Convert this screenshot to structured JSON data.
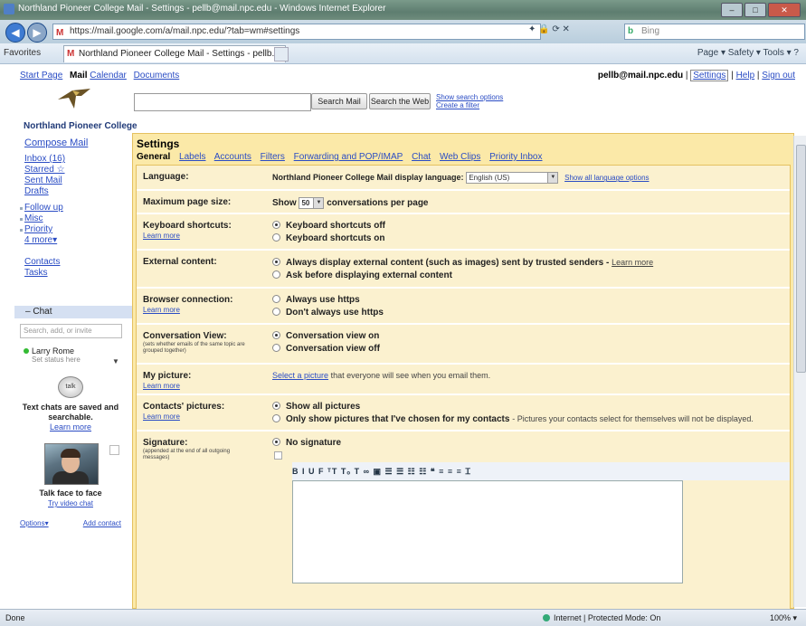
{
  "browser": {
    "window_title": "Northland Pioneer College Mail - Settings - pellb@mail.npc.edu - Windows Internet Explorer",
    "address": "https://mail.google.com/a/mail.npc.edu/?tab=wm#settings",
    "search_placeholder": "Bing",
    "favorites_label": "Favorites",
    "tab_title": "Northland Pioneer College Mail - Settings - pellb...",
    "addr_tools": "✦ 🔒 ⟳ ✕",
    "right_tools": "Page ▾   Safety ▾   Tools ▾   ?",
    "status_left": "Done",
    "zone": "Internet | Protected Mode: On",
    "zoom": "100%"
  },
  "gbar": {
    "start_page": "Start Page",
    "mail": "Mail",
    "calendar": "Calendar",
    "documents": "Documents",
    "email": "pellb@mail.npc.edu",
    "settings": "Settings",
    "help": "Help",
    "sign_out": "Sign out"
  },
  "logo": {
    "name": "Northland Pioneer College"
  },
  "search": {
    "search_mail": "Search Mail",
    "search_web": "Search the Web",
    "show_options": "Show search options",
    "create_filter": "Create a filter"
  },
  "nav": {
    "compose": "Compose Mail",
    "items": [
      "Inbox (16)",
      "Starred ☆",
      "Sent Mail",
      "Drafts"
    ],
    "labels": [
      "Follow up",
      "Misc",
      "Priority",
      "4 more▾"
    ],
    "contacts": "Contacts",
    "tasks": "Tasks"
  },
  "chat": {
    "header": "Chat",
    "search_placeholder": "Search, add, or invite",
    "contact_name": "Larry Rome",
    "contact_status": "Set status here",
    "talk_label": "talk",
    "saved_text": "Text chats are saved and searchable.",
    "learn_more": "Learn more",
    "face_title": "Talk face to face",
    "face_link": "Try video chat",
    "options": "Options▾",
    "add_contact": "Add contact"
  },
  "settings": {
    "title": "Settings",
    "tabs": [
      "General",
      "Labels",
      "Accounts",
      "Filters",
      "Forwarding and POP/IMAP",
      "Chat",
      "Web Clips",
      "Priority Inbox"
    ],
    "language": {
      "label": "Language:",
      "text": "Northland Pioneer College Mail display language:",
      "value": "English (US)",
      "link": "Show all language options"
    },
    "page_size": {
      "label": "Maximum page size:",
      "show": "Show",
      "value": "50",
      "suffix": "conversations per page"
    },
    "keyboard": {
      "label": "Keyboard shortcuts:",
      "learn": "Learn more",
      "opt1": "Keyboard shortcuts off",
      "opt2": "Keyboard shortcuts on"
    },
    "external": {
      "label": "External content:",
      "opt1": "Always display external content (such as images) sent by trusted senders",
      "learn": "Learn more",
      "opt2": "Ask before displaying external content"
    },
    "browser_conn": {
      "label": "Browser connection:",
      "learn": "Learn more",
      "opt1": "Always use https",
      "opt2": "Don't always use https"
    },
    "conversation": {
      "label": "Conversation View:",
      "hint": "(sets whether emails of the same topic are grouped together)",
      "opt1": "Conversation view on",
      "opt2": "Conversation view off"
    },
    "picture": {
      "label": "My picture:",
      "learn": "Learn more",
      "link": "Select a picture",
      "text": "that everyone will see when you email them."
    },
    "contacts_pic": {
      "label": "Contacts' pictures:",
      "learn": "Learn more",
      "opt1": "Show all pictures",
      "opt2": "Only show pictures that I've chosen for my contacts",
      "opt2_suffix": "- Pictures your contacts select for themselves will not be displayed."
    },
    "signature": {
      "label": "Signature:",
      "hint": "(appended at the end of all outgoing messages)",
      "opt1": "No signature",
      "toolbar": "B  I  U  F  ᵀT  Tₒ  T  ∞  ▣  ☰  ☰  ☷  ☷  ❝  ≡  ≡  ≡  Ꮖ"
    }
  }
}
